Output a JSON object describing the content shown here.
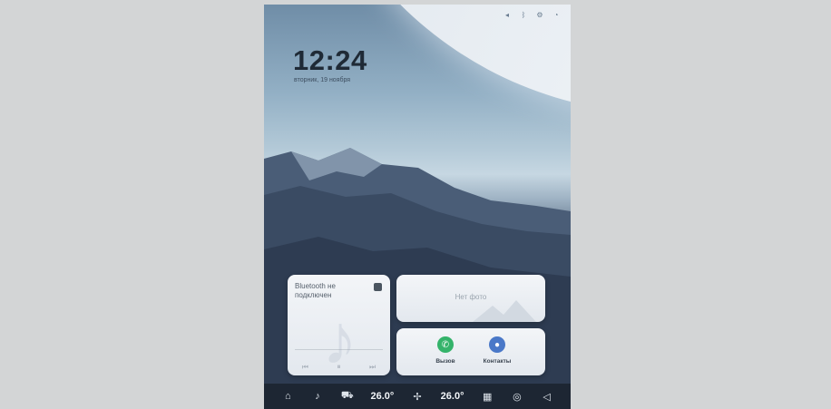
{
  "status_icons": [
    "signal-icon",
    "bluetooth-icon",
    "settings-icon",
    "user-icon"
  ],
  "lock": {
    "time": "12:24",
    "date": "вторник, 19 ноября"
  },
  "music": {
    "title": "Bluetooth не подключен",
    "controls": [
      "prev-icon",
      "pause-icon",
      "next-icon"
    ]
  },
  "photo": {
    "label": "Нет фото"
  },
  "contacts": {
    "call_label": "Вызов",
    "contacts_label": "Контакты"
  },
  "dock": {
    "temp_left": "26.0°",
    "temp_right": "26.0°"
  },
  "colors": {
    "call": "#34b36a",
    "contacts": "#4a78c8",
    "dock": "#1d2633"
  }
}
